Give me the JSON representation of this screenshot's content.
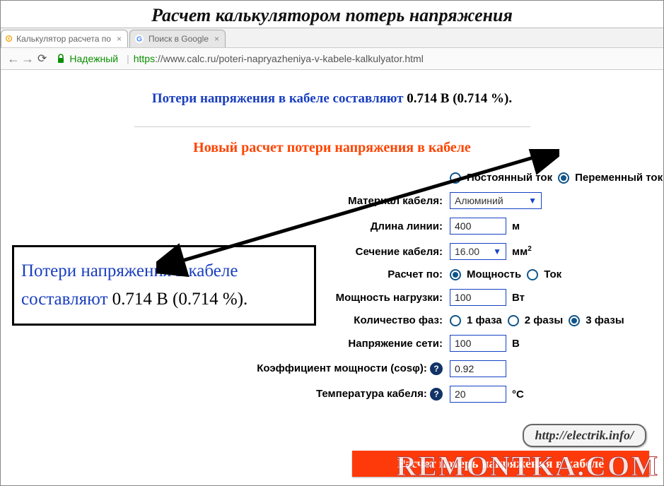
{
  "page_heading": "Расчет калькулятором потерь напряжения",
  "browser": {
    "tabs": [
      {
        "title": "Калькулятор расчета по",
        "favicon": "kc"
      },
      {
        "title": "Поиск в Google",
        "favicon": "g"
      }
    ],
    "secure_label": "Надежный",
    "url_scheme": "https",
    "url_rest": "://www.calc.ru/poteri-napryazheniya-v-kabele-kalkulyator.html"
  },
  "result": {
    "prefix": "Потери напряжения в кабеле составляют ",
    "value": "0.714 В (0.714 %)."
  },
  "section_title": "Новый расчет потери напряжения в кабеле",
  "form": {
    "current": {
      "dc": "Постоянный ток",
      "ac": "Переменный ток",
      "selected": "ac"
    },
    "material": {
      "label": "Материал кабеля:",
      "value": "Алюминий"
    },
    "length": {
      "label": "Длина линии:",
      "value": "400",
      "unit": "м"
    },
    "section": {
      "label": "Сечение кабеля:",
      "value": "16.00",
      "unit_base": "мм",
      "unit_sup": "2"
    },
    "calc_by": {
      "label": "Расчет по:",
      "power": "Мощность",
      "current": "Ток",
      "selected": "power"
    },
    "load": {
      "label": "Мощность нагрузки:",
      "value": "100",
      "unit": "Вт"
    },
    "phases": {
      "label": "Количество фаз:",
      "p1": "1 фаза",
      "p2": "2 фазы",
      "p3": "3 фазы",
      "selected": "p3"
    },
    "voltage": {
      "label": "Напряжение сети:",
      "value": "100",
      "unit": "В"
    },
    "cosphi": {
      "label": "Коэффициент мощности (cosφ):",
      "value": "0.92"
    },
    "temp": {
      "label": "Температура кабеля:",
      "value": "20",
      "unit": "°С"
    }
  },
  "callout": {
    "prefix": "Потери напряжения в кабеле составляют ",
    "value": "0.714 В (0.714 %)."
  },
  "bottom": {
    "link_text": "http://electrik.info/",
    "button": "Расчет потерь напряжения в кабеле",
    "watermark": "REMONTKA.COM"
  }
}
